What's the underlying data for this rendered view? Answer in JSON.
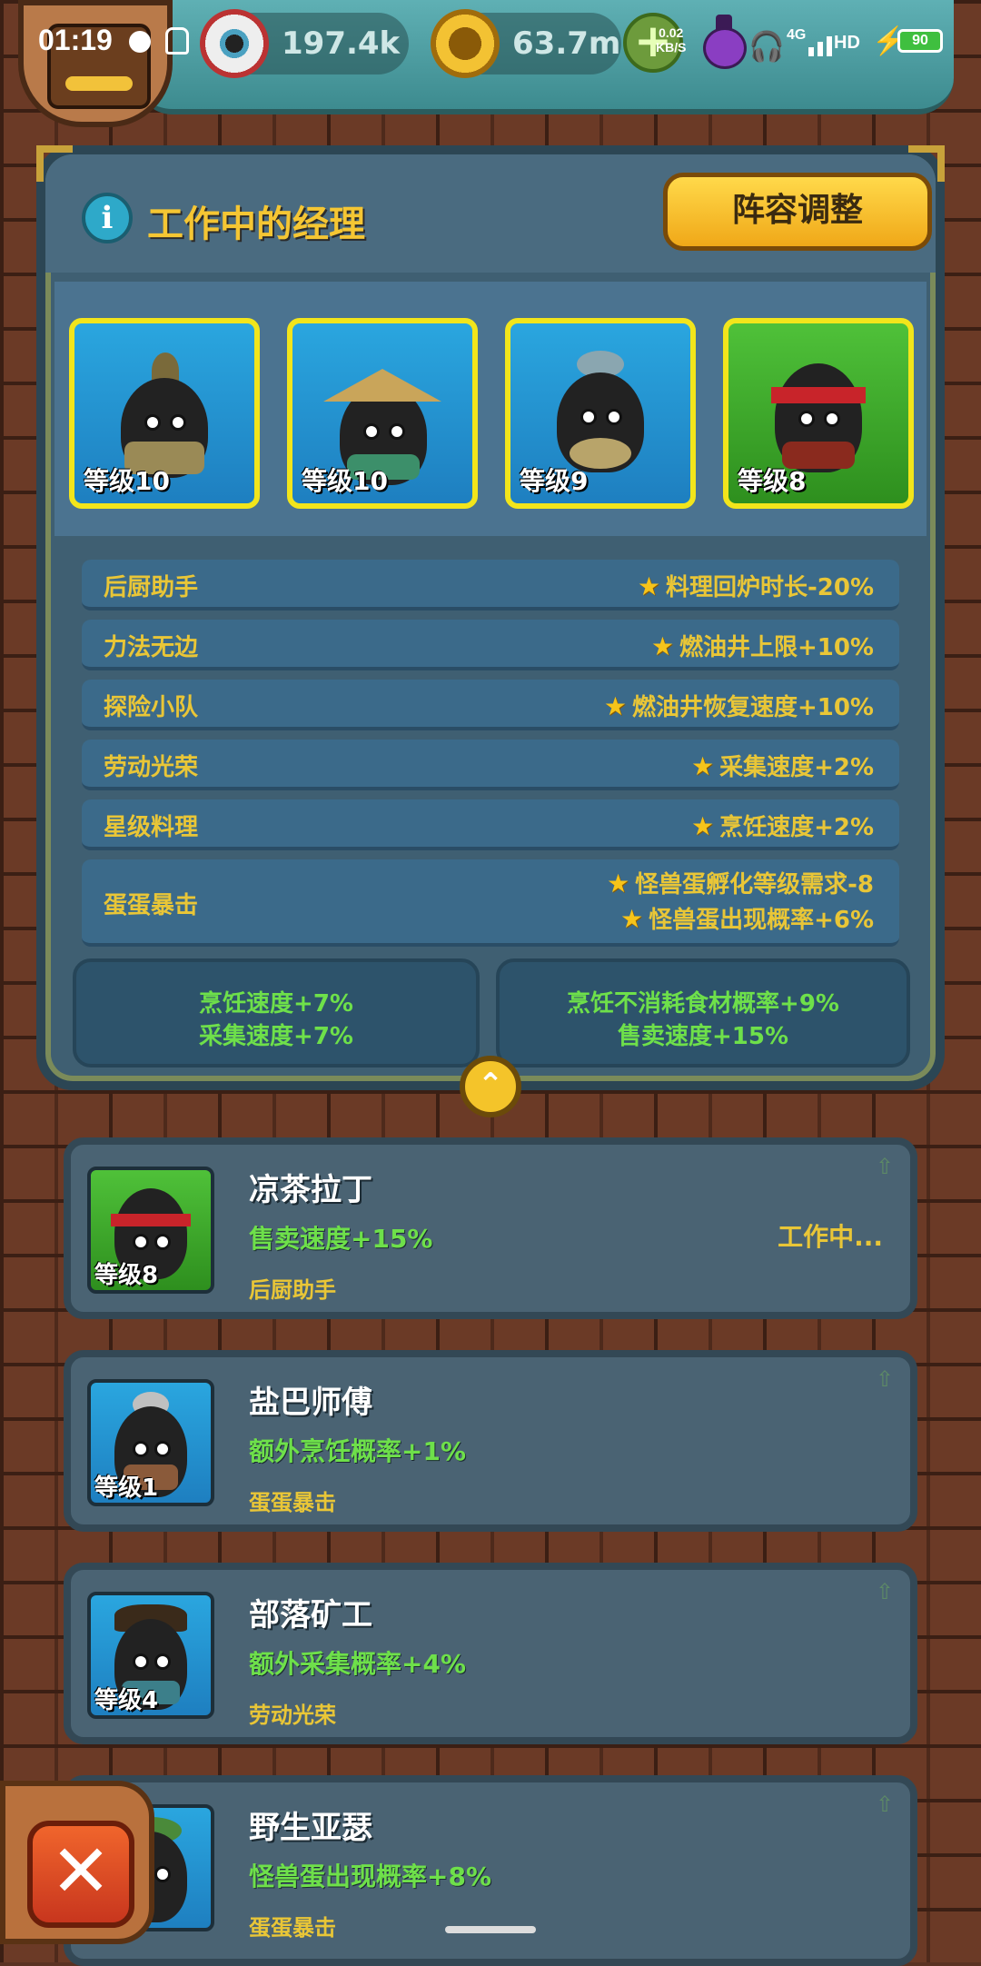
{
  "status_bar": {
    "time": "01:19",
    "net_speed_value": "0.02",
    "net_speed_unit": "KB/S",
    "network": "4G",
    "signal_label": "HD",
    "battery": "90"
  },
  "resources": {
    "eyeballs": "197.4k",
    "coins": "63.7m",
    "add_label": "+"
  },
  "panel": {
    "title": "工作中的经理",
    "info_label": "i",
    "lineup_button": "阵容调整"
  },
  "working_managers": [
    {
      "level": "等级10",
      "card_color": "blue"
    },
    {
      "level": "等级10",
      "card_color": "blue"
    },
    {
      "level": "等级9",
      "card_color": "blue"
    },
    {
      "level": "等级8",
      "card_color": "green"
    }
  ],
  "buffs": [
    {
      "name": "后厨助手",
      "effects": [
        "料理回炉时长-20%"
      ]
    },
    {
      "name": "力法无边",
      "effects": [
        "燃油井上限+10%"
      ]
    },
    {
      "name": "探险小队",
      "effects": [
        "燃油井恢复速度+10%"
      ]
    },
    {
      "name": "劳动光荣",
      "effects": [
        "采集速度+2%"
      ]
    },
    {
      "name": "星级料理",
      "effects": [
        "烹饪速度+2%"
      ]
    },
    {
      "name": "蛋蛋暴击",
      "effects": [
        "怪兽蛋孵化等级需求-8",
        "怪兽蛋出现概率+6%"
      ]
    }
  ],
  "summary": {
    "left": [
      "烹饪速度+7%",
      "采集速度+7%"
    ],
    "right": [
      "烹饪不消耗食材概率+9%",
      "售卖速度+15%"
    ]
  },
  "collapse_label": "⌃",
  "manager_list": [
    {
      "name": "凉茶拉丁",
      "bonus": "售卖速度+15%",
      "skill": "后厨助手",
      "level": "等级8",
      "status": "工作中...",
      "card_color": "green"
    },
    {
      "name": "盐巴师傅",
      "bonus": "额外烹饪概率+1%",
      "skill": "蛋蛋暴击",
      "level": "等级1",
      "status": "",
      "card_color": "blue"
    },
    {
      "name": "部落矿工",
      "bonus": "额外采集概率+4%",
      "skill": "劳动光荣",
      "level": "等级4",
      "status": "",
      "card_color": "blue"
    },
    {
      "name": "野生亚瑟",
      "bonus": "怪兽蛋出现概率+8%",
      "skill": "蛋蛋暴击",
      "level": "",
      "status": "",
      "card_color": "blue"
    }
  ],
  "close_label": "✕",
  "colors": {
    "accent_yellow": "#f5c633",
    "bonus_green": "#6ee04a",
    "card_blue": "#2aa6df",
    "card_green": "#4fc139",
    "card_border": "#f2e51b"
  },
  "icons": [
    "eyeball-icon",
    "coin-icon",
    "plus-icon",
    "potion-icon",
    "info-icon",
    "star-icon",
    "chevron-up-icon",
    "close-icon",
    "upgrade-arrow-icon"
  ]
}
